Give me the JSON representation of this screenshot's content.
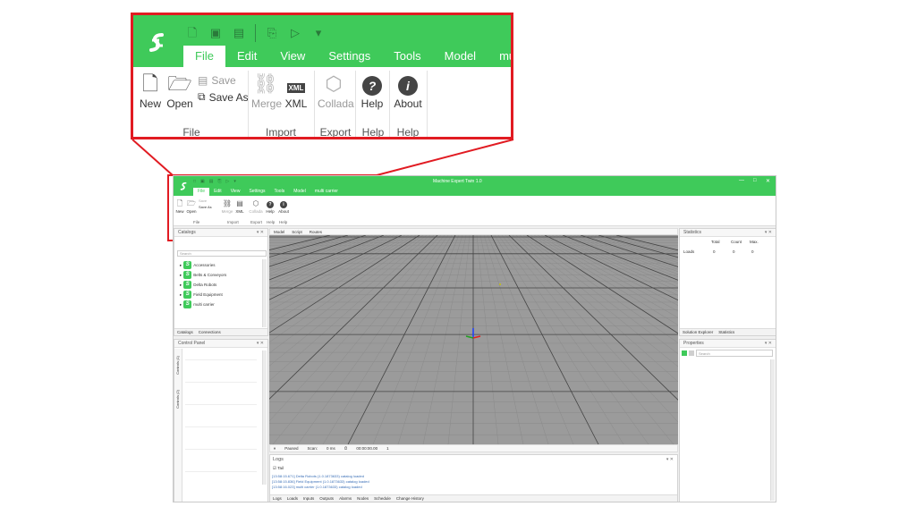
{
  "zoom": {
    "tabs": [
      "File",
      "Edit",
      "View",
      "Settings",
      "Tools",
      "Model",
      "multi carrier"
    ],
    "active_tab": "File",
    "quick_access": [
      "new-doc-icon",
      "save-icon",
      "save-disabled-icon",
      "paste-icon",
      "play-icon",
      "dropdown-icon"
    ],
    "buttons": {
      "new": "New",
      "open": "Open",
      "save": "Save",
      "save_as": "Save As",
      "merge": "Merge",
      "xml": "XML",
      "collada": "Collada",
      "help": "Help",
      "about": "About"
    },
    "groups": {
      "file": "File",
      "import": "Import",
      "export": "Export",
      "help1": "Help",
      "help2": "Help"
    },
    "xml_badge": "XML",
    "help_glyph": "?",
    "about_glyph": "i"
  },
  "app": {
    "title": "Machine Expert Twin 1.0",
    "window_buttons": [
      "—",
      "□",
      "✕"
    ],
    "tabs": [
      "File",
      "Edit",
      "View",
      "Settings",
      "Tools",
      "Model",
      "multi carrier"
    ],
    "ribbon": {
      "new": "New",
      "open": "Open",
      "save": "Save",
      "save_as": "Save As",
      "merge": "Merge",
      "xml": "XML",
      "collada": "Collada",
      "help": "Help",
      "about": "About",
      "groups": {
        "file": "File",
        "import": "Import",
        "export": "Export",
        "help1": "Help",
        "help2": "Help"
      }
    },
    "catalogs": {
      "title": "Catalogs",
      "search_placeholder": "Search",
      "items": [
        "Accessories",
        "Belts & Conveyors",
        "Delta Robots",
        "Field Equipment",
        "multi carrier"
      ],
      "tabs": [
        "Catalogs",
        "Connections"
      ]
    },
    "control_panel": {
      "title": "Control Panel",
      "side_tabs": [
        "Controls (1)",
        "Controls (2)"
      ]
    },
    "viewport": {
      "tabs": [
        "Model",
        "Script",
        "Routes"
      ],
      "status": [
        "Paused",
        "Scan:",
        "0 ms",
        "00:00:00.00",
        "1"
      ]
    },
    "logs": {
      "title": "Logs",
      "tail_label": "Tail",
      "lines": [
        "[13:58:15.671] Delta Robots (1.0.1873633) catalog loaded",
        "[13:58:15.836] Field Equipment (1.0.1873633) catalog loaded",
        "[13:58:16.023] multi carrier (1.0.1873633) catalog loaded"
      ],
      "tabs": [
        "Logs",
        "Loads",
        "Inputs",
        "Outputs",
        "Alarms",
        "Nodes",
        "Schedule",
        "Change History"
      ]
    },
    "statistics": {
      "title": "Statistics",
      "columns": [
        "Total",
        "Count",
        "Max."
      ],
      "rows": [
        {
          "label": "Loads",
          "values": [
            "0",
            "0",
            "0"
          ]
        }
      ],
      "tabs": [
        "Solution Explorer",
        "Statistics"
      ]
    },
    "properties": {
      "title": "Properties",
      "search_placeholder": "Search"
    },
    "pin_glyphs": "▾ ✕"
  },
  "colors": {
    "brand_green": "#3fca5a",
    "callout_red": "#e11b22",
    "viewport_gray": "#9b9b9b"
  }
}
